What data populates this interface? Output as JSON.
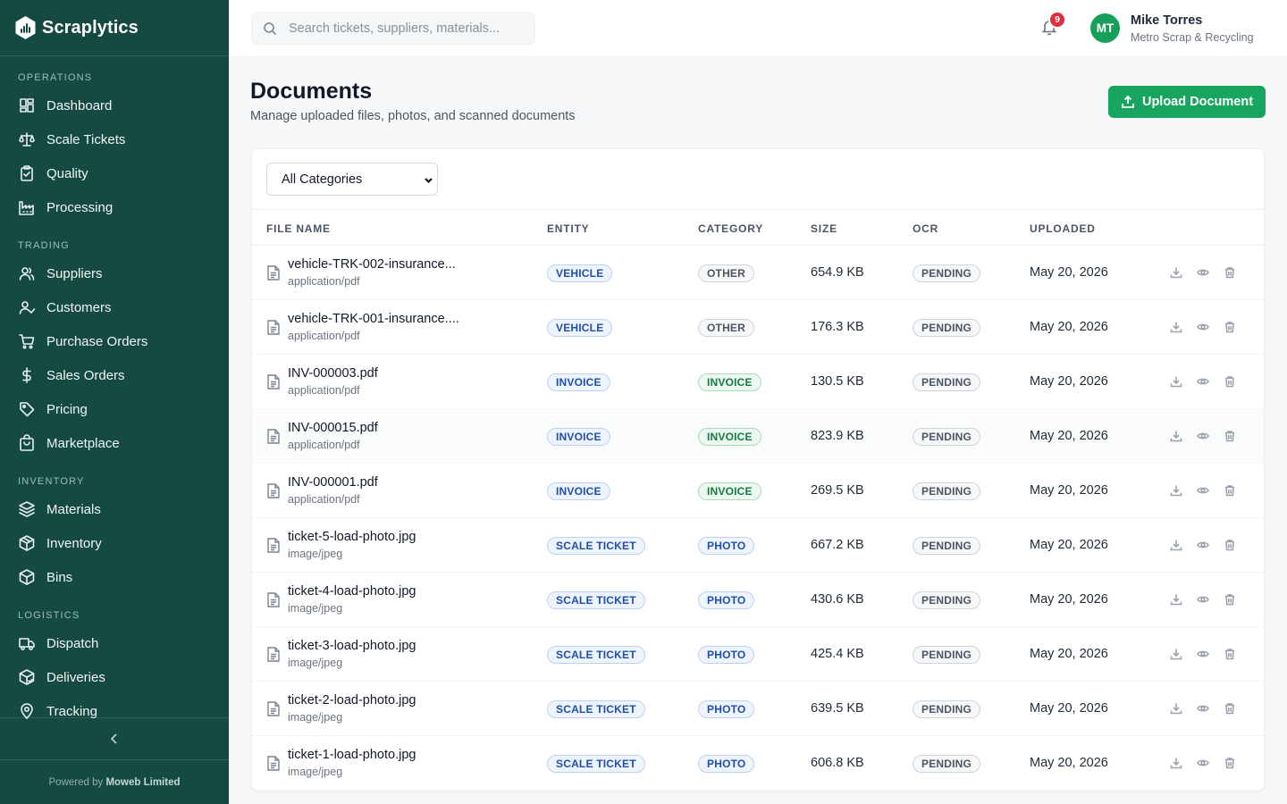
{
  "brand": {
    "name": "Scraplytics"
  },
  "sidebar": {
    "sections": [
      {
        "title": "OPERATIONS",
        "items": [
          {
            "label": "Dashboard",
            "icon": "dashboard-icon"
          },
          {
            "label": "Scale Tickets",
            "icon": "scale-icon"
          },
          {
            "label": "Quality",
            "icon": "clipboard-check-icon"
          },
          {
            "label": "Processing",
            "icon": "factory-icon"
          }
        ]
      },
      {
        "title": "TRADING",
        "items": [
          {
            "label": "Suppliers",
            "icon": "users-icon"
          },
          {
            "label": "Customers",
            "icon": "user-check-icon"
          },
          {
            "label": "Purchase Orders",
            "icon": "cart-icon"
          },
          {
            "label": "Sales Orders",
            "icon": "dollar-icon"
          },
          {
            "label": "Pricing",
            "icon": "tag-icon"
          },
          {
            "label": "Marketplace",
            "icon": "store-icon"
          }
        ]
      },
      {
        "title": "INVENTORY",
        "items": [
          {
            "label": "Materials",
            "icon": "layers-icon"
          },
          {
            "label": "Inventory",
            "icon": "box-icon"
          },
          {
            "label": "Bins",
            "icon": "package-icon"
          }
        ]
      },
      {
        "title": "LOGISTICS",
        "items": [
          {
            "label": "Dispatch",
            "icon": "truck-icon"
          },
          {
            "label": "Deliveries",
            "icon": "package-check-icon"
          },
          {
            "label": "Tracking",
            "icon": "map-pin-icon"
          }
        ]
      }
    ],
    "footer_prefix": "Powered by ",
    "footer_company": "Moweb Limited"
  },
  "header": {
    "search_placeholder": "Search tickets, suppliers, materials...",
    "notification_count": "9",
    "user_initials": "MT",
    "user_name": "Mike Torres",
    "user_org": "Metro Scrap & Recycling"
  },
  "page": {
    "title": "Documents",
    "subtitle": "Manage uploaded files, photos, and scanned documents",
    "upload_label": "Upload Document",
    "filter_value": "All Categories"
  },
  "table": {
    "columns": [
      "FILE NAME",
      "ENTITY",
      "CATEGORY",
      "SIZE",
      "OCR",
      "UPLOADED"
    ],
    "rows": [
      {
        "name": "vehicle-TRK-002-insurance...",
        "type": "application/pdf",
        "entity": "VEHICLE",
        "category": "OTHER",
        "size": "654.9 KB",
        "ocr": "PENDING",
        "uploaded": "May 20, 2026"
      },
      {
        "name": "vehicle-TRK-001-insurance....",
        "type": "application/pdf",
        "entity": "VEHICLE",
        "category": "OTHER",
        "size": "176.3 KB",
        "ocr": "PENDING",
        "uploaded": "May 20, 2026"
      },
      {
        "name": "INV-000003.pdf",
        "type": "application/pdf",
        "entity": "INVOICE",
        "category": "INVOICE",
        "size": "130.5 KB",
        "ocr": "PENDING",
        "uploaded": "May 20, 2026"
      },
      {
        "name": "INV-000015.pdf",
        "type": "application/pdf",
        "entity": "INVOICE",
        "category": "INVOICE",
        "size": "823.9 KB",
        "ocr": "PENDING",
        "uploaded": "May 20, 2026"
      },
      {
        "name": "INV-000001.pdf",
        "type": "application/pdf",
        "entity": "INVOICE",
        "category": "INVOICE",
        "size": "269.5 KB",
        "ocr": "PENDING",
        "uploaded": "May 20, 2026"
      },
      {
        "name": "ticket-5-load-photo.jpg",
        "type": "image/jpeg",
        "entity": "SCALE TICKET",
        "category": "PHOTO",
        "size": "667.2 KB",
        "ocr": "PENDING",
        "uploaded": "May 20, 2026"
      },
      {
        "name": "ticket-4-load-photo.jpg",
        "type": "image/jpeg",
        "entity": "SCALE TICKET",
        "category": "PHOTO",
        "size": "430.6 KB",
        "ocr": "PENDING",
        "uploaded": "May 20, 2026"
      },
      {
        "name": "ticket-3-load-photo.jpg",
        "type": "image/jpeg",
        "entity": "SCALE TICKET",
        "category": "PHOTO",
        "size": "425.4 KB",
        "ocr": "PENDING",
        "uploaded": "May 20, 2026"
      },
      {
        "name": "ticket-2-load-photo.jpg",
        "type": "image/jpeg",
        "entity": "SCALE TICKET",
        "category": "PHOTO",
        "size": "639.5 KB",
        "ocr": "PENDING",
        "uploaded": "May 20, 2026"
      },
      {
        "name": "ticket-1-load-photo.jpg",
        "type": "image/jpeg",
        "entity": "SCALE TICKET",
        "category": "PHOTO",
        "size": "606.8 KB",
        "ocr": "PENDING",
        "uploaded": "May 20, 2026"
      }
    ]
  },
  "colors": {
    "sidebar_bg": "#154a43",
    "accent_green": "#17a55f",
    "badge_red": "#e02d3c"
  }
}
